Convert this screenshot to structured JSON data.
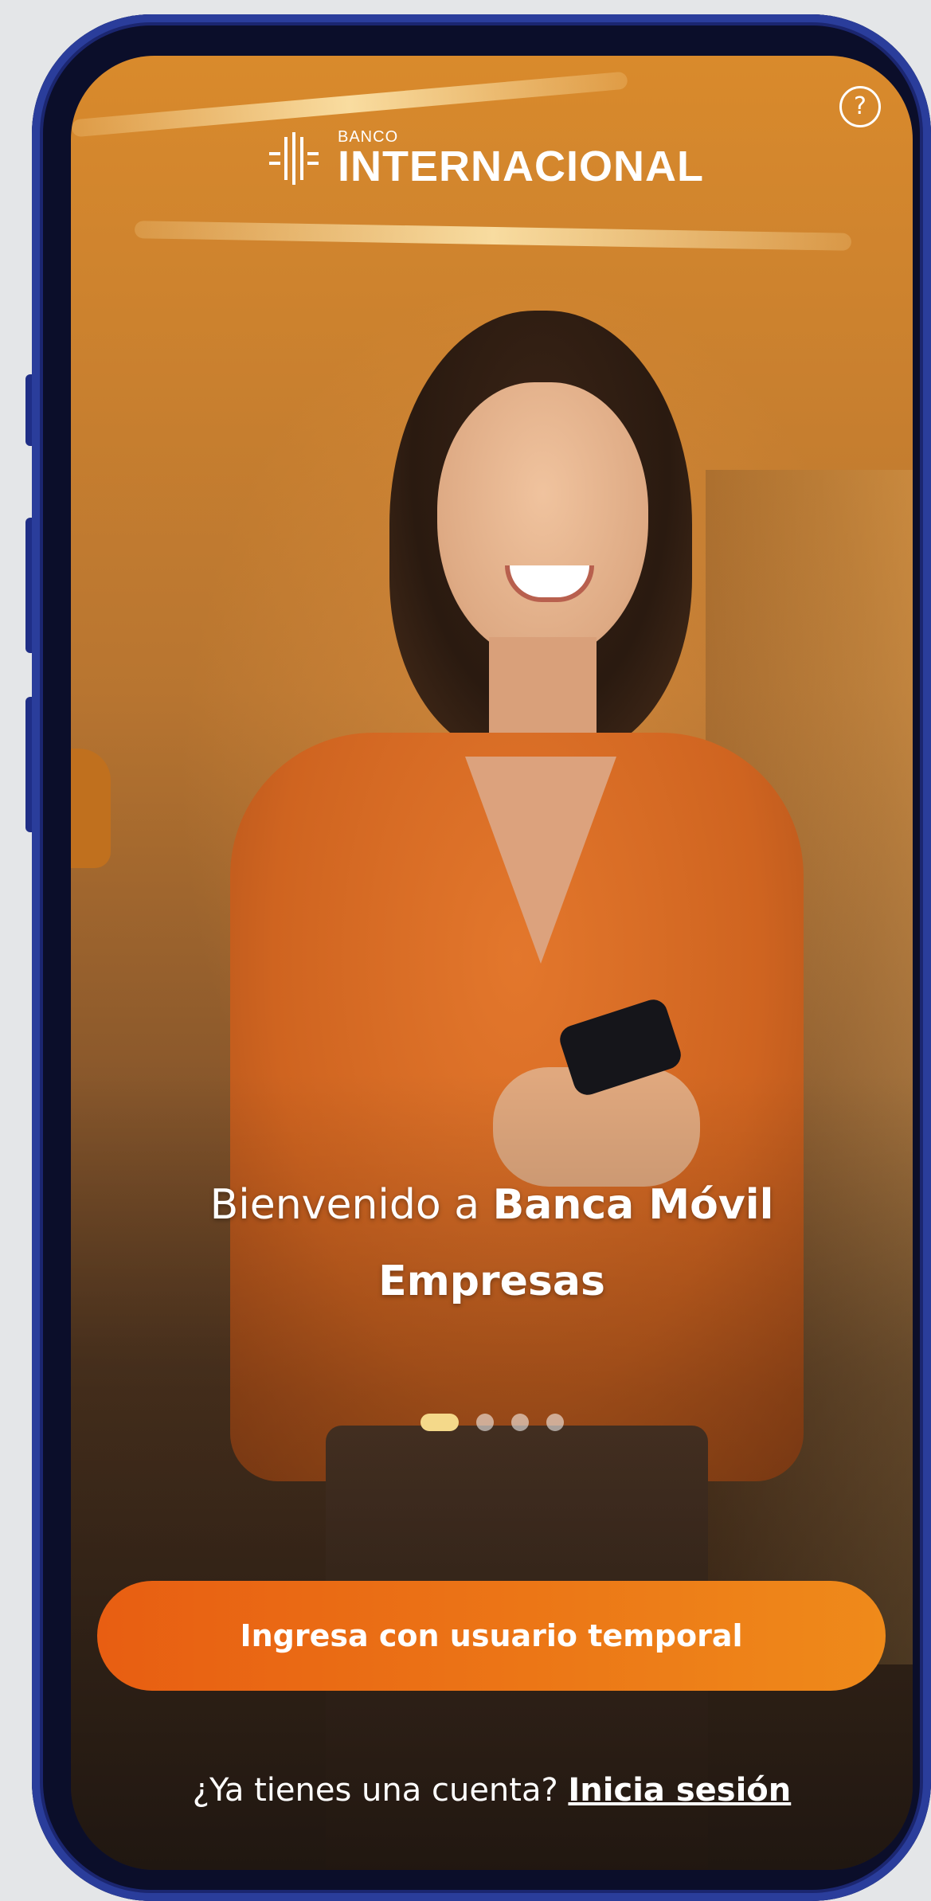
{
  "header": {
    "logo_small": "BANCO",
    "logo_big": "INTERNACIONAL",
    "help_icon": "?"
  },
  "welcome": {
    "prefix": "Bienvenido a ",
    "brand_line1": "Banca Móvil",
    "brand_line2": "Empresas"
  },
  "carousel": {
    "total": 4,
    "active_index": 0
  },
  "cta": {
    "label": "Ingresa con usuario temporal"
  },
  "login": {
    "question": "¿Ya tienes una cuenta? ",
    "link": "Inicia sesión"
  },
  "colors": {
    "cta_start": "#e85e12",
    "cta_end": "#ef8a1a",
    "device_frame": "#2a3d9b",
    "dot_active": "#f4d98a"
  }
}
